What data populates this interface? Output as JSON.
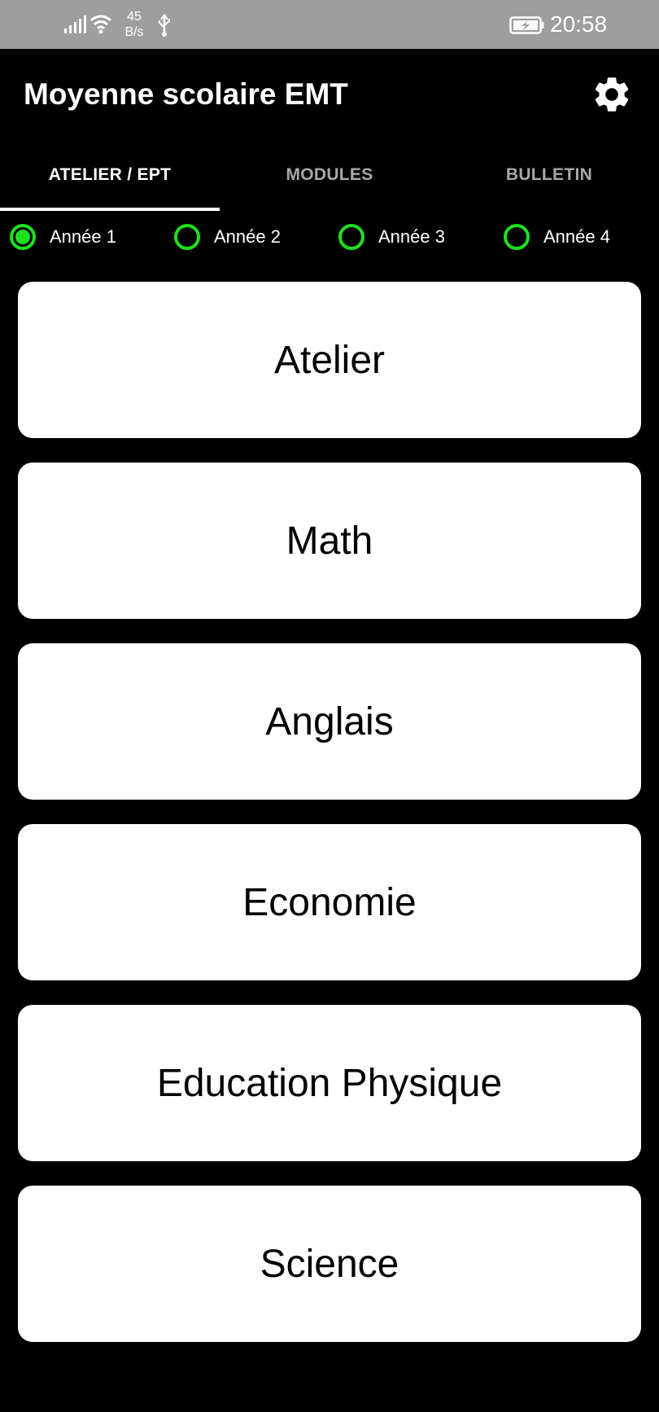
{
  "status_bar": {
    "net_speed_value": "45",
    "net_speed_unit": "B/s",
    "time": "20:58",
    "icons": [
      "signal-icon",
      "wifi-icon",
      "usb-icon",
      "battery-charging-icon"
    ]
  },
  "app_bar": {
    "title": "Moyenne scolaire EMT",
    "settings_icon": "gear-icon"
  },
  "tabs": [
    {
      "label": "ATELIER / EPT",
      "active": true
    },
    {
      "label": "MODULES",
      "active": false
    },
    {
      "label": "BULLETIN",
      "active": false
    }
  ],
  "years": [
    {
      "label": "Année 1",
      "selected": true
    },
    {
      "label": "Année 2",
      "selected": false
    },
    {
      "label": "Année 3",
      "selected": false
    },
    {
      "label": "Année 4",
      "selected": false
    }
  ],
  "modules": [
    {
      "label": "Atelier"
    },
    {
      "label": "Math"
    },
    {
      "label": "Anglais"
    },
    {
      "label": "Economie"
    },
    {
      "label": "Education Physique"
    },
    {
      "label": "Science"
    }
  ],
  "colors": {
    "background": "#000000",
    "status_bar": "#9e9e9e",
    "accent_radio": "#1ee01e",
    "card": "#ffffff",
    "tab_inactive": "#a8a8a8"
  }
}
